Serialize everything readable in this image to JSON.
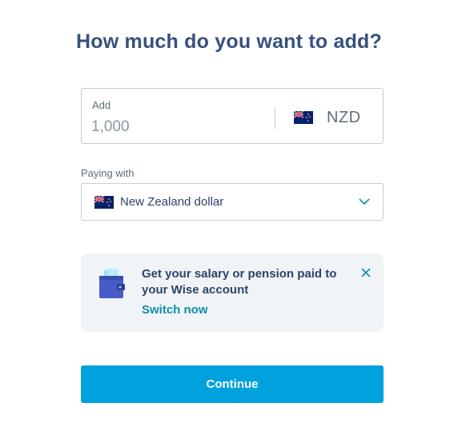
{
  "title": "How much do you want to add?",
  "amount": {
    "label": "Add",
    "placeholder": "1,000",
    "currency_code": "NZD",
    "currency_flag": "nz-flag-icon"
  },
  "paying_with": {
    "label": "Paying with",
    "selected": "New Zealand dollar",
    "flag": "nz-flag-icon"
  },
  "promo": {
    "icon": "wallet-icon",
    "text": "Get your salary or pension paid to your Wise account",
    "link": "Switch now"
  },
  "continue_label": "Continue",
  "colors": {
    "heading": "#37517e",
    "accent": "#00a2dd",
    "link": "#0f8ea8",
    "promo_bg": "#f0f4f7"
  }
}
